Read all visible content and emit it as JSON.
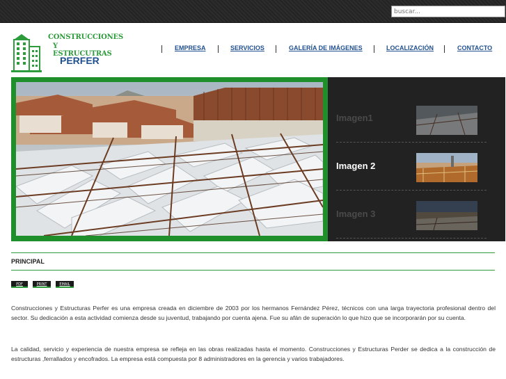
{
  "topbar": {
    "search_placeholder": "buscar..."
  },
  "logo": {
    "line1": "CONSTRUCCIONES",
    "line2": "Y ESTRUCUTRAS",
    "line3": "PERFER"
  },
  "nav": {
    "items": [
      {
        "label": "EMPRESA"
      },
      {
        "label": "SERVICIOS"
      },
      {
        "label": "GALERÍA DE IMÁGENES"
      },
      {
        "label": "LOCALIZACIÓN"
      },
      {
        "label": "CONTACTO"
      }
    ]
  },
  "slider": {
    "items": [
      {
        "label": "Imagen1",
        "active": false
      },
      {
        "label": "Imagen 2",
        "active": true
      },
      {
        "label": "Imagen 3",
        "active": false
      }
    ]
  },
  "content": {
    "section_title": "PRINCIPAL",
    "buttons": {
      "pdf": "PDF",
      "print": "PRINT",
      "email": "EMAIL"
    },
    "paragraph1": "Construcciones y Estructuras Perfer es una empresa creada en diciembre de 2003 por los hermanos Fernández Pérez, técnicos con una larga trayectoria profesional dentro del sector. Su dedicación a esta actividad comienza desde su juventud, trabajando por cuenta ajena. Fue su afán de superación lo que hizo que se incorporarán por su cuenta.",
    "paragraph2": "La calidad, servicio y experiencia de nuestra empresa se refleja en las obras realizadas hasta el momento. Construcciones y Estructuras Perder se dedica a la construcción de estructuras ,ferrallados y encofrados. La empresa está compuesta por 8 administradores en la gerencia y varios trabajadores."
  },
  "colors": {
    "brand_green": "#2e9b3c",
    "brand_blue": "#1f4f8f",
    "topbar": "#242424"
  }
}
